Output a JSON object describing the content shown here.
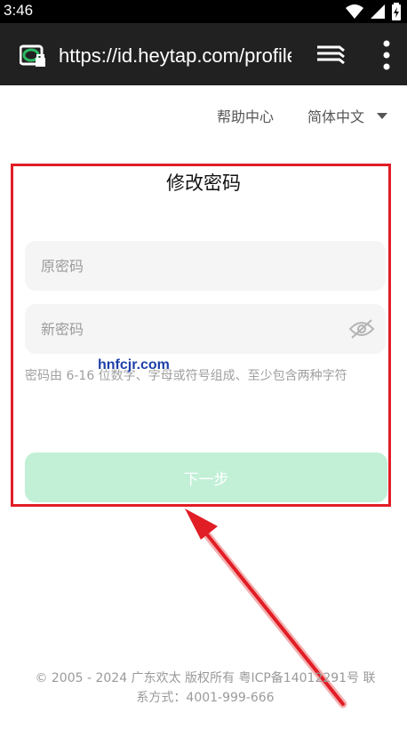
{
  "status_bar": {
    "time": "3:46"
  },
  "browser": {
    "url": "https://id.heytap.com/profile"
  },
  "header": {
    "help_label": "帮助中心",
    "language_label": "简体中文"
  },
  "form": {
    "title": "修改密码",
    "old_password_placeholder": "原密码",
    "new_password_placeholder": "新密码",
    "hint": "密码由 6-16 位数字、字母或符号组成、至少包含两种字符",
    "next_label": "下一步"
  },
  "watermark": "hnfcjr.com",
  "footer": {
    "line1": "© 2005 - 2024 广东欢太 版权所有 粤ICP备14012291号 联",
    "line2": "系方式：4001-999-666"
  },
  "colors": {
    "highlight": "#e11d25",
    "accent_button_disabled": "#c1f0d6",
    "field_bg": "#f5f5f5",
    "browser_bar": "#212121"
  }
}
